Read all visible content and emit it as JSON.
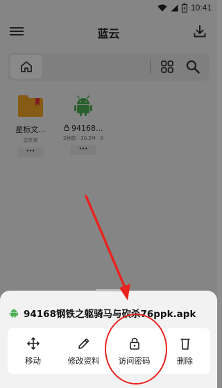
{
  "status_bar": {
    "time": "10:41"
  },
  "app_bar": {
    "title": "蓝云"
  },
  "path_bar": {},
  "files": [
    {
      "name": "星标文...",
      "meta": "文件夹",
      "type": "folder"
    },
    {
      "name": "94168...",
      "meta": "2秒前 · 30.2M · 0",
      "type": "apk"
    }
  ],
  "sheet": {
    "file_name": "94168钢铁之躯骑马与砍杀76ppk.apk",
    "actions": [
      {
        "label": "移动",
        "icon": "move-icon"
      },
      {
        "label": "修改资料",
        "icon": "edit-icon"
      },
      {
        "label": "访问密码",
        "icon": "lock-icon"
      },
      {
        "label": "删除",
        "icon": "delete-icon"
      }
    ]
  },
  "colors": {
    "annotation_red": "#e8231f",
    "android_green": "#4caf50",
    "folder_orange": "#f5a623",
    "folder_bookmark": "#e53935"
  }
}
